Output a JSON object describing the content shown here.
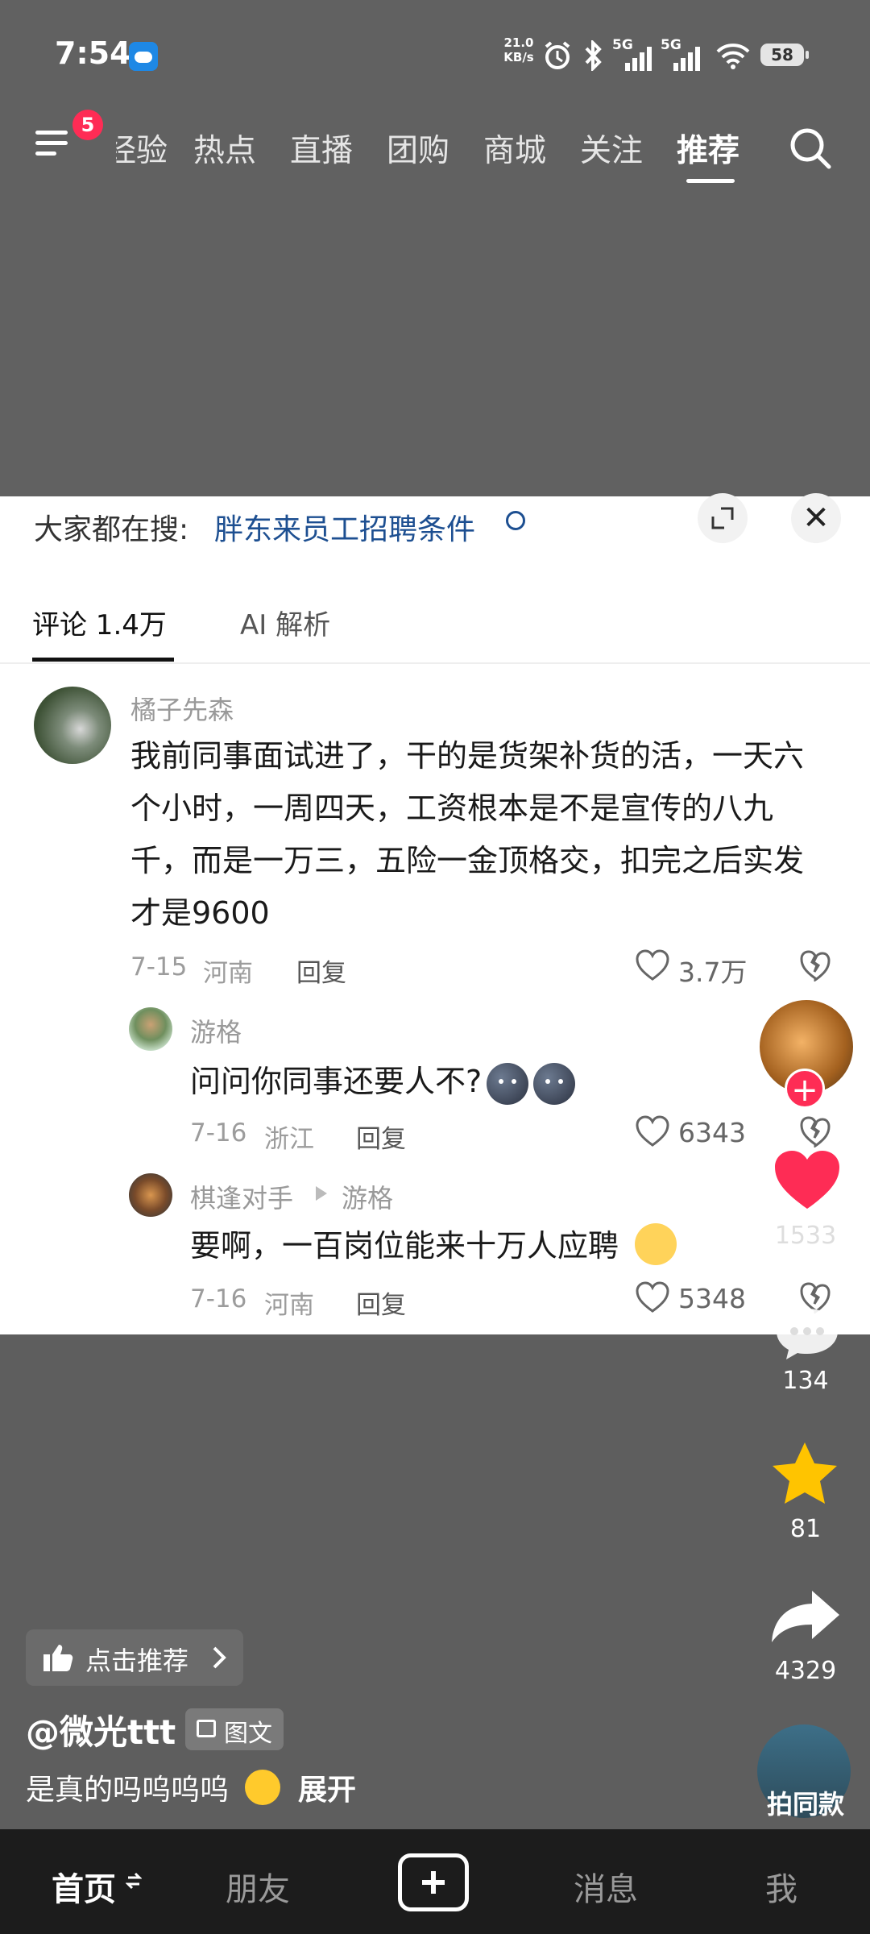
{
  "status_bar": {
    "time": "7:54",
    "net_speed_value": "21.0",
    "net_speed_unit": "KB/s",
    "network_labels": [
      "5G",
      "5G"
    ],
    "battery": "58"
  },
  "top_nav": {
    "menu_badge": "5",
    "tabs": [
      "经验",
      "热点",
      "直播",
      "团购",
      "商城",
      "关注",
      "推荐"
    ],
    "active_tab": "推荐"
  },
  "comment_panel": {
    "search_hint_label": "大家都在搜:",
    "search_hint_query": "胖东来员工招聘条件",
    "tabs": [
      "评论 1.4万",
      "AI 解析"
    ],
    "comments": [
      {
        "user": "橘子先森",
        "text_lines": [
          "我前同事面试进了，干的是货架补货的活，一天六",
          "个小时，一周四天，工资根本是不是宣传的八九",
          "千，而是一万三，五险一金顶格交，扣完之后实发",
          "才是9600"
        ],
        "date": "7-15",
        "location": "河南",
        "reply_label": "回复",
        "likes": "3.7万"
      },
      {
        "user": "游格",
        "text": "问问你同事还要人不?",
        "date": "7-16",
        "location": "浙江",
        "reply_label": "回复",
        "likes": "6343"
      },
      {
        "user": "棋逢对手",
        "reply_to": "游格",
        "text": "要啊，一百岗位能来十万人应聘",
        "date": "7-16",
        "location": "河南",
        "reply_label": "回复",
        "likes": "5348"
      }
    ]
  },
  "actions": {
    "likes": "1533",
    "comments": "134",
    "favorites": "81",
    "shares": "4329",
    "music_label": "拍同款"
  },
  "post": {
    "recommend_label": "点击推荐",
    "author": "@微光ttt",
    "type_badge": "图文",
    "caption": "是真的吗呜呜呜",
    "expand_label": "展开"
  },
  "bottom_nav": {
    "home": "首页",
    "friends": "朋友",
    "messages": "消息",
    "me": "我"
  },
  "colors": {
    "accent_red": "#fe2c55",
    "link_blue": "#1d4f91",
    "star_yellow": "#ffc400"
  }
}
